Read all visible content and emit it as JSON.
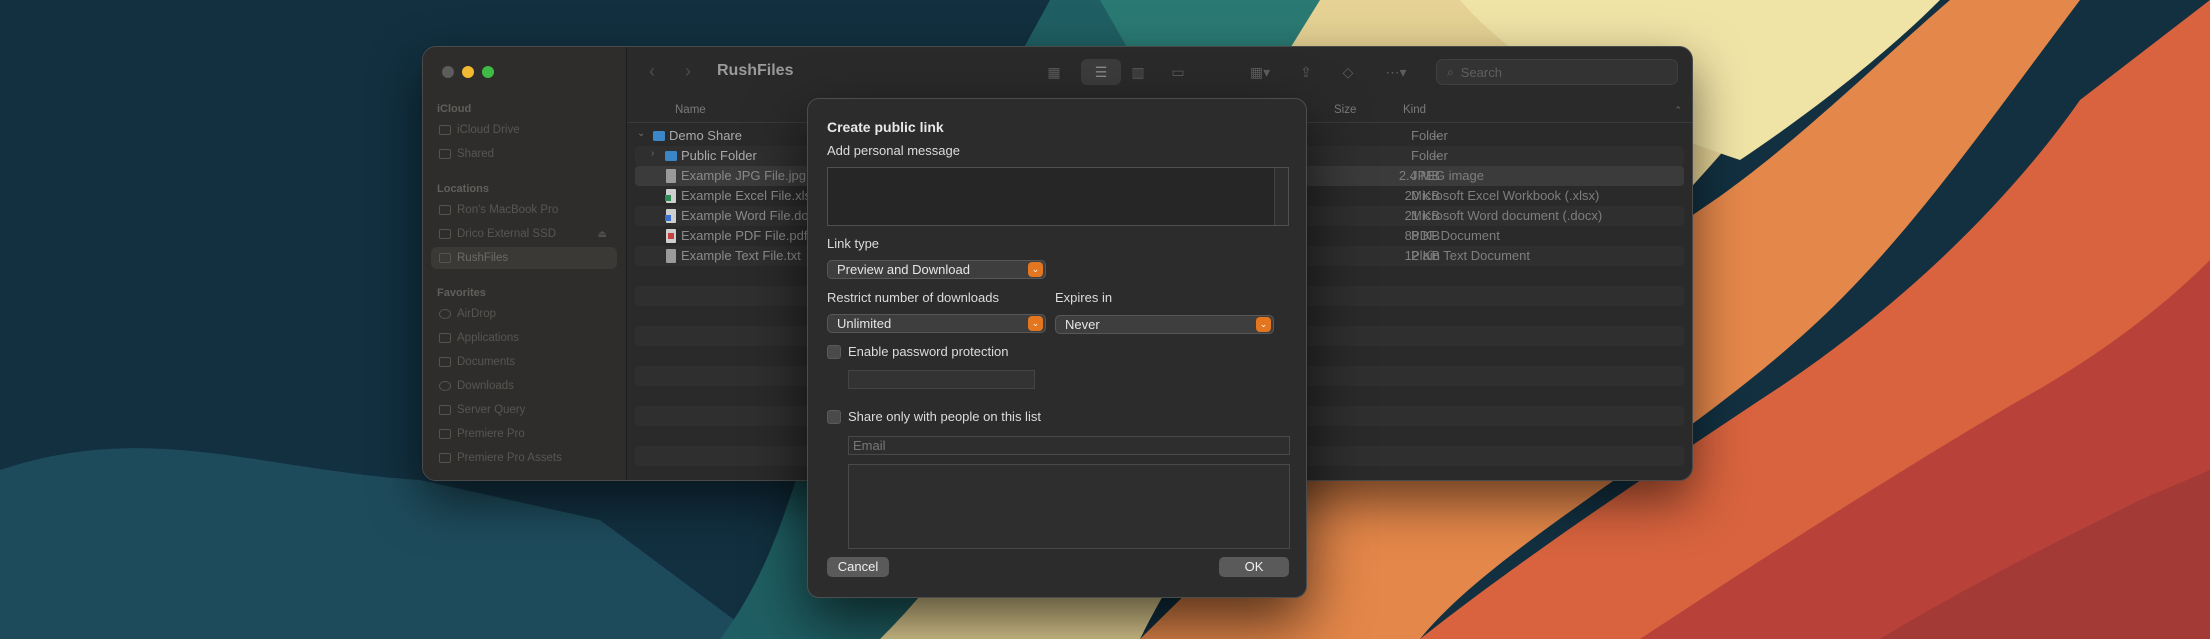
{
  "finder": {
    "title": "RushFiles",
    "search_placeholder": "Search",
    "sidebar": {
      "sections": [
        {
          "label": "iCloud",
          "items": [
            {
              "label": "iCloud Drive",
              "icon": "cloud-icon"
            },
            {
              "label": "Shared",
              "icon": "shared-folder-icon"
            }
          ]
        },
        {
          "label": "Locations",
          "items": [
            {
              "label": "Ron's MacBook Pro",
              "icon": "laptop-icon"
            },
            {
              "label": "Drico External SSD",
              "icon": "drive-icon",
              "eject": "⏏"
            },
            {
              "label": "RushFiles",
              "icon": "cloud-icon",
              "selected": true
            }
          ]
        },
        {
          "label": "Favorites",
          "items": [
            {
              "label": "AirDrop",
              "icon": "airdrop-icon"
            },
            {
              "label": "Applications",
              "icon": "applications-icon"
            },
            {
              "label": "Documents",
              "icon": "document-icon"
            },
            {
              "label": "Downloads",
              "icon": "downloads-icon"
            },
            {
              "label": "Server Query",
              "icon": "folder-icon"
            },
            {
              "label": "Premiere Pro",
              "icon": "folder-icon"
            },
            {
              "label": "Premiere Pro Assets",
              "icon": "folder-icon"
            }
          ]
        }
      ]
    },
    "columns": {
      "name": "Name",
      "size": "Size",
      "kind": "Kind"
    },
    "files": [
      {
        "name": "Demo Share",
        "size": "--",
        "kind": "Folder",
        "icon": "folder-icon",
        "color": "#3a86c8",
        "expanded": true
      },
      {
        "name": "Public Folder",
        "size": "--",
        "kind": "Folder",
        "icon": "folder-icon",
        "color": "#3a86c8"
      },
      {
        "name": "Example JPG File.jpg",
        "size": "2.4 MB",
        "kind": "JPEG image",
        "icon": "image-file-icon",
        "color": "#9a9a9a"
      },
      {
        "name": "Example Excel File.xlsx",
        "size": "20 KB",
        "kind": "Microsoft Excel Workbook (.xlsx)",
        "icon": "excel-file-icon",
        "color": "#2e8b57"
      },
      {
        "name": "Example Word File.docx",
        "size": "21 KB",
        "kind": "Microsoft Word document (.docx)",
        "icon": "word-file-icon",
        "color": "#3a6fd0"
      },
      {
        "name": "Example PDF File.pdf",
        "size": "88 KB",
        "kind": "PDF Document",
        "icon": "pdf-file-icon",
        "color": "#c94040"
      },
      {
        "name": "Example Text File.txt",
        "size": "12 KB",
        "kind": "Plain Text Document",
        "icon": "text-file-icon",
        "color": "#9a9a9a"
      }
    ]
  },
  "dialog": {
    "title": "Create public link",
    "message_label": "Add personal message",
    "link_type_label": "Link type",
    "link_type_value": "Preview and Download",
    "restrict_label": "Restrict number of downloads",
    "restrict_value": "Unlimited",
    "expires_label": "Expires in",
    "expires_value": "Never",
    "password_label": "Enable password protection",
    "share_list_label": "Share only with people on this list",
    "email_placeholder": "Email",
    "cancel_label": "Cancel",
    "ok_label": "OK",
    "accent_color": "#e3761f"
  }
}
